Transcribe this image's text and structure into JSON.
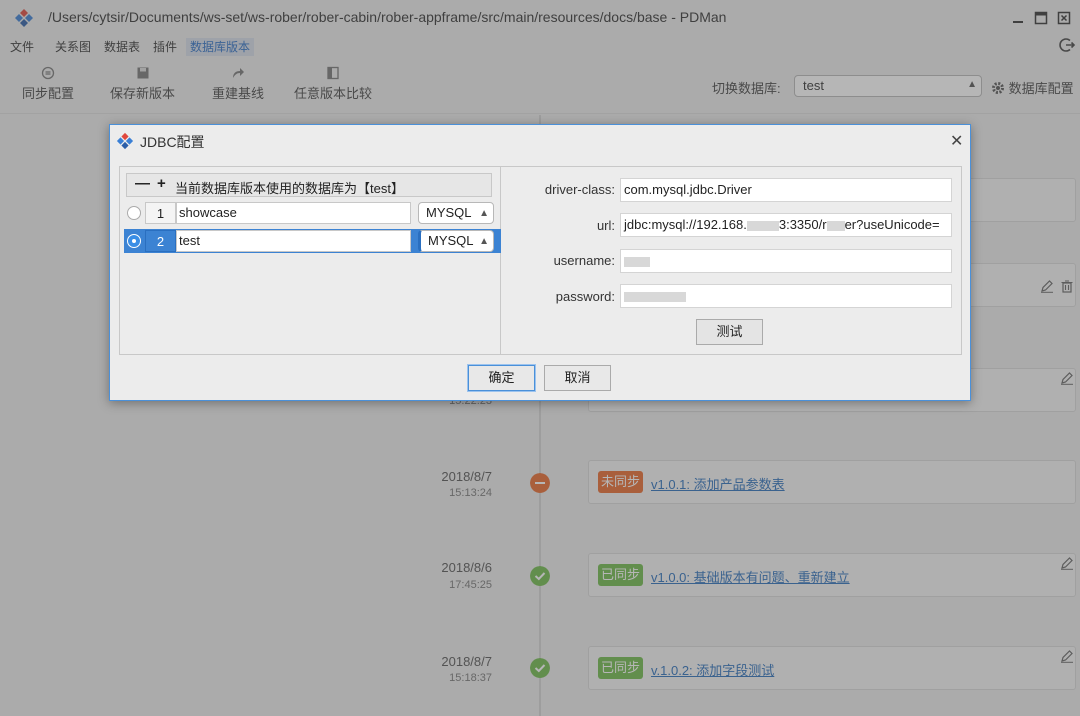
{
  "window": {
    "title": "/Users/cytsir/Documents/ws-set/ws-rober/rober-cabin/rober-appframe/src/main/resources/docs/base - PDMan"
  },
  "menu": {
    "items": [
      {
        "label": "文件"
      },
      {
        "label": "关系图"
      },
      {
        "label": "数据表"
      },
      {
        "label": "插件"
      },
      {
        "label": "数据库版本",
        "active": true
      }
    ]
  },
  "toolbar": {
    "sync_config": "同步配置",
    "save_version": "保存新版本",
    "rebuild_baseline": "重建基线",
    "compare_versions": "任意版本比较",
    "switch_db_label": "切换数据库:",
    "switch_db_value": "test",
    "db_config": "数据库配置"
  },
  "timeline": {
    "entries": [
      {
        "date": "2018/8/7",
        "time": "15:13:24",
        "status": "未同步",
        "status_color": "#e8692e",
        "link": "v1.0.1: 添加产品参数表"
      },
      {
        "date": "2018/8/6",
        "time": "17:45:25",
        "status": "已同步",
        "status_color": "#6fba4a",
        "link": "v1.0.0: 基础版本有问题、重新建立"
      },
      {
        "date": "2018/8/7",
        "time": "15:18:37",
        "status": "已同步",
        "status_color": "#6fba4a",
        "link": "v.1.0.2: 添加字段测试"
      }
    ],
    "partial_time": "15:22:23"
  },
  "dialog": {
    "title": "JDBC配置",
    "header_text": "当前数据库版本使用的数据库为【test】",
    "rows": [
      {
        "index": "1",
        "name": "showcase",
        "type": "MYSQL",
        "selected": false
      },
      {
        "index": "2",
        "name": "test",
        "type": "MYSQL",
        "selected": true
      }
    ],
    "fields": {
      "driver_label": "driver-class:",
      "driver_value": "com.mysql.jdbc.Driver",
      "url_label": "url:",
      "url_prefix": "jdbc:mysql://192.168.",
      "url_mid": "3:3350/r",
      "url_suffix": "er?useUnicode=",
      "username_label": "username:",
      "password_label": "password:"
    },
    "test_button": "测试",
    "ok_button": "确定",
    "cancel_button": "取消"
  },
  "colors": {
    "accent": "#3c83d3",
    "unsynced": "#e8692e",
    "synced": "#6fba4a"
  }
}
